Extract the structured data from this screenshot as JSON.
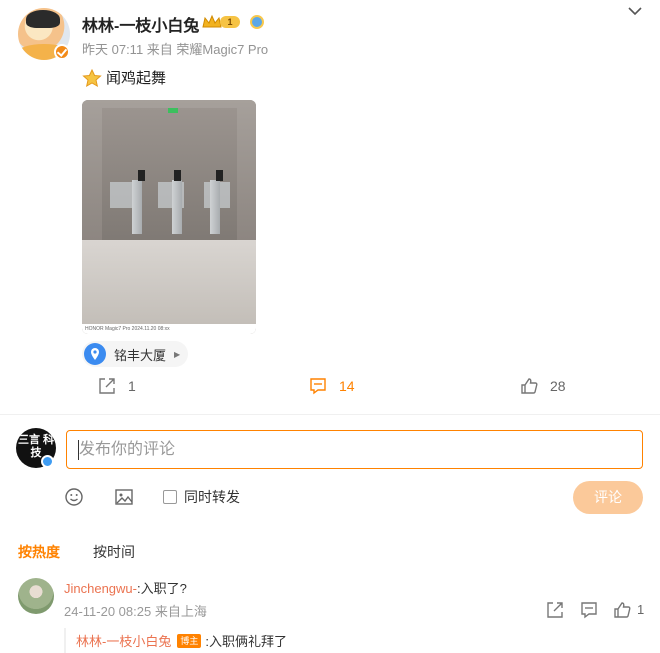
{
  "post": {
    "username": "林林-一枝小白兔",
    "level_badge": "1",
    "meta": "昨天 07:11 来自 荣耀Magic7 Pro",
    "text": "闻鸡起舞",
    "photo_watermark": "HONOR Magic7 Pro   2024.11.20 08:xx",
    "location": "铭丰大厦"
  },
  "actions": {
    "repost_count": "1",
    "comment_count": "14",
    "like_count": "28"
  },
  "composer": {
    "avatar_text": "三言 科技",
    "placeholder": "发布你的评论",
    "forward_label": "同时转发",
    "submit_label": "评论"
  },
  "sort": {
    "hot": "按热度",
    "time": "按时间"
  },
  "comment": {
    "user": "Jinchengwu-",
    "text": ":入职了?",
    "meta": "24-11-20 08:25 来自上海",
    "like_count": "1",
    "reply": {
      "user": "林林-一枝小白兔",
      "badge": "博主",
      "text": ":入职俩礼拜了"
    }
  },
  "icons": {
    "accent": "#ff8200",
    "link_color": "#eb7350",
    "names": [
      "chevron-down-icon",
      "verified-icon",
      "crown-icon",
      "emoji-icon",
      "image-icon",
      "repost-icon",
      "comment-icon",
      "like-icon",
      "location-pin-icon"
    ]
  }
}
